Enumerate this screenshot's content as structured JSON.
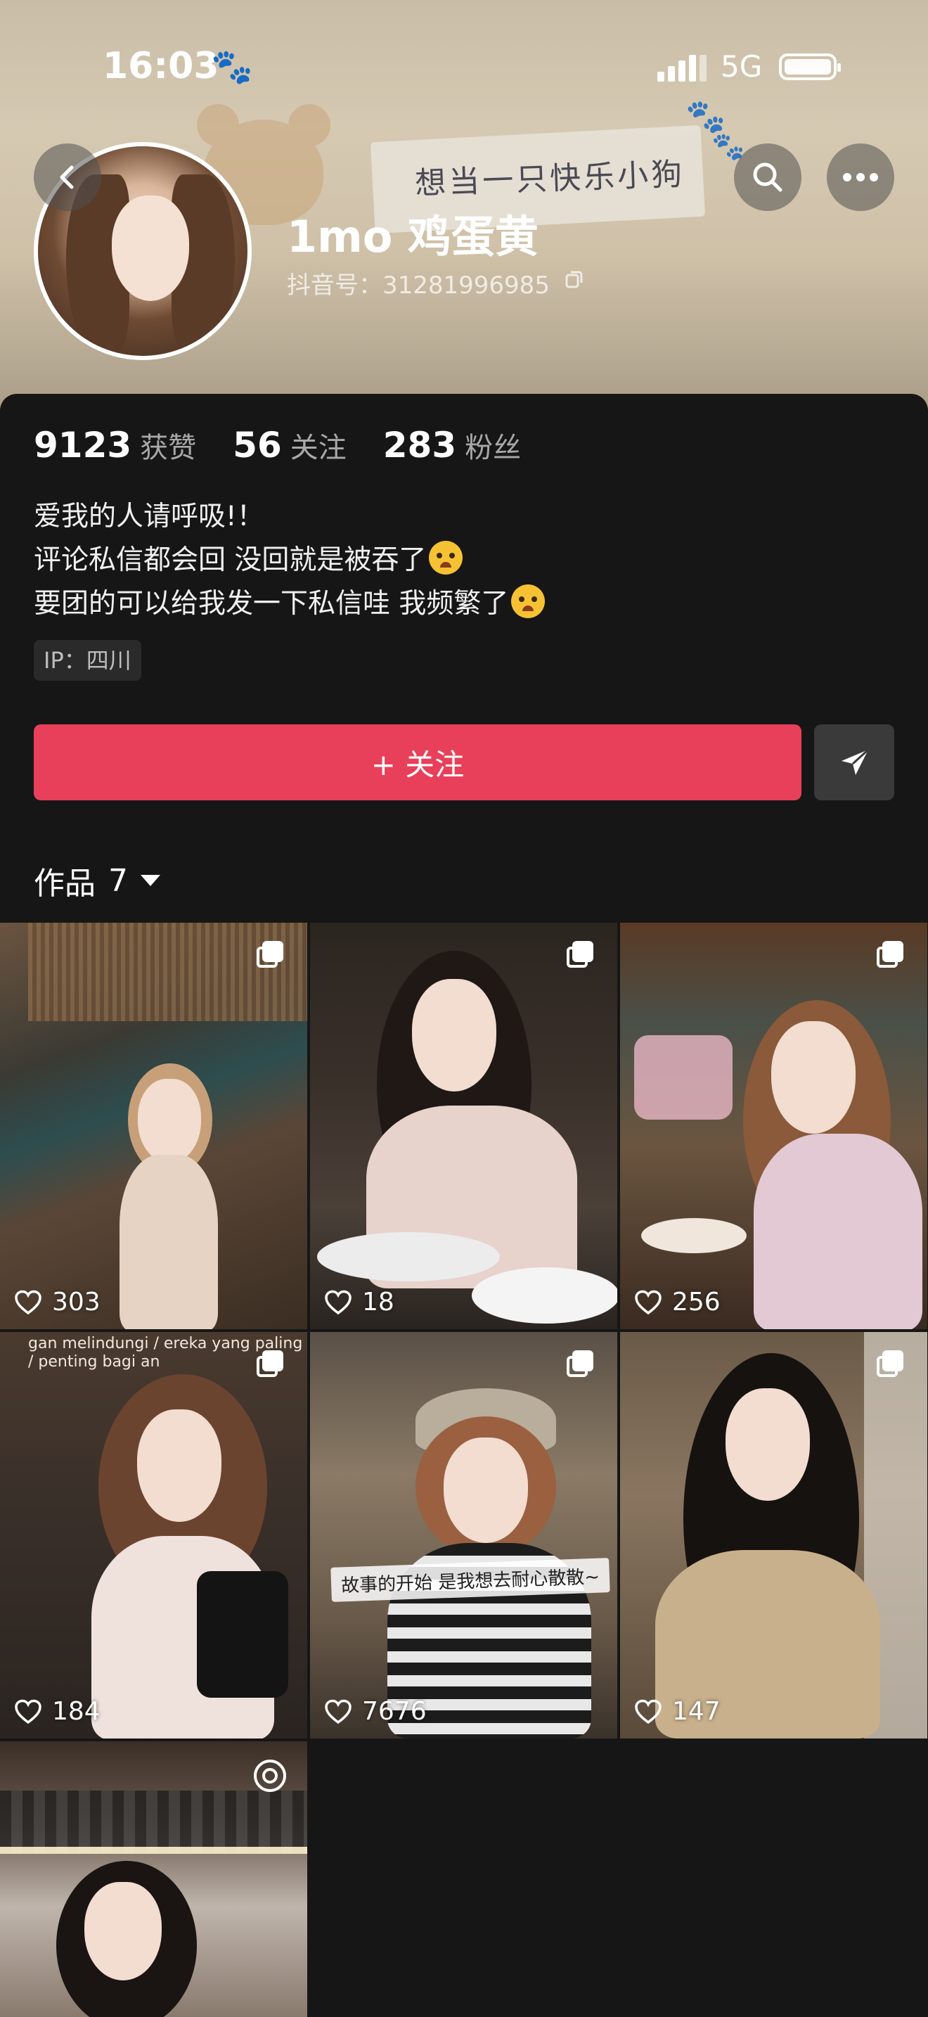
{
  "status_bar": {
    "time": "16:03",
    "network": "5G"
  },
  "banner": {
    "slogan": "想当一只快乐小狗"
  },
  "profile": {
    "nickname": "1mo 鸡蛋黄",
    "account_id": "抖音号：31281996985",
    "stats": [
      {
        "value": "9123",
        "label": "获赞"
      },
      {
        "value": "56",
        "label": "关注"
      },
      {
        "value": "283",
        "label": "粉丝"
      }
    ],
    "bio_lines": [
      "爱我的人请呼吸!！",
      "评论私信都会回 没回就是被吞了",
      "要团的可以给我发一下私信哇 我频繁了"
    ],
    "ip": "IP：四川"
  },
  "actions": {
    "follow_label": "+ 关注"
  },
  "works": {
    "tab_label": "作品",
    "count": "7",
    "items": [
      {
        "likes": "303",
        "badge": "multi"
      },
      {
        "likes": "18",
        "badge": "multi"
      },
      {
        "likes": "256",
        "badge": "multi"
      },
      {
        "likes": "184",
        "badge": "multi",
        "overlay_text": "gan melindungi / ereka yang paling / penting bagi an"
      },
      {
        "likes": "7676",
        "badge": "multi",
        "caption": "故事的开始 是我想去耐心散散~"
      },
      {
        "likes": "147",
        "badge": "multi"
      },
      {
        "likes": "",
        "badge": "live"
      }
    ]
  },
  "colors": {
    "accent": "#e8405a",
    "background": "#161616"
  }
}
